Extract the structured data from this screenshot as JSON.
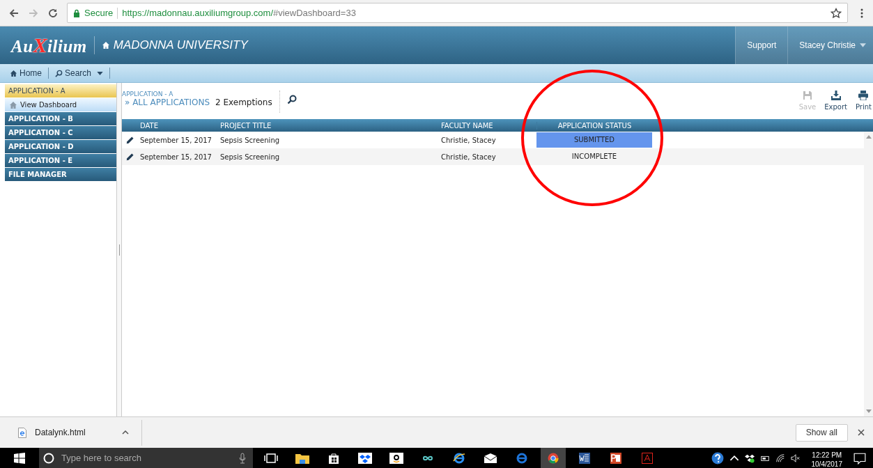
{
  "browser": {
    "secure_label": "Secure",
    "url_host": "https://madonnau.auxiliumgroup.com/",
    "url_path": "#viewDashboard=33"
  },
  "header": {
    "logo": [
      {
        "text": "Au",
        "accent": false
      },
      {
        "text": "X",
        "accent": true
      },
      {
        "text": "ilium",
        "accent": false
      }
    ],
    "institution": "MADONNA UNIVERSITY",
    "links": [
      "Support"
    ],
    "user": "Stacey Christie"
  },
  "nav": [
    {
      "label": "Home",
      "kind": "home"
    },
    {
      "label": "Search",
      "kind": "search"
    }
  ],
  "sidebar": {
    "items": [
      {
        "label": "APPLICATION - A",
        "selected": true,
        "children": [
          {
            "label": "View Dashboard",
            "selected": true
          }
        ]
      },
      {
        "label": "APPLICATION - B",
        "selected": false
      },
      {
        "label": "APPLICATION - C",
        "selected": false
      },
      {
        "label": "APPLICATION - D",
        "selected": false
      },
      {
        "label": "APPLICATION - E",
        "selected": false
      },
      {
        "label": "FILE MANAGER",
        "selected": false
      }
    ]
  },
  "breadcrumb": {
    "parent": "APPLICATION - A",
    "current": "» ALL APPLICATIONS",
    "count": "2 Exemptions"
  },
  "tools": [
    {
      "label": "Save",
      "kind": "save",
      "disabled": true
    },
    {
      "label": "Export",
      "kind": "export",
      "disabled": false
    },
    {
      "label": "Print",
      "kind": "print",
      "disabled": false
    }
  ],
  "table": {
    "columns": [
      "DATE",
      "PROJECT TITLE",
      "FACULTY NAME",
      "APPLICATION STATUS"
    ],
    "rows": [
      {
        "date": "September 15, 2017",
        "title": "Sepsis Screening",
        "faculty": "Christie, Stacey",
        "status": "SUBMITTED",
        "selected": true
      },
      {
        "date": "September 15, 2017",
        "title": "Sepsis Screening",
        "faculty": "Christie, Stacey",
        "status": "INCOMPLETE",
        "selected": false
      }
    ]
  },
  "downloads": {
    "file": "Datalynk.html",
    "show_all": "Show all"
  },
  "taskbar": {
    "search_placeholder": "Type here to search",
    "time": "12:22 PM",
    "date": "10/4/2017"
  }
}
